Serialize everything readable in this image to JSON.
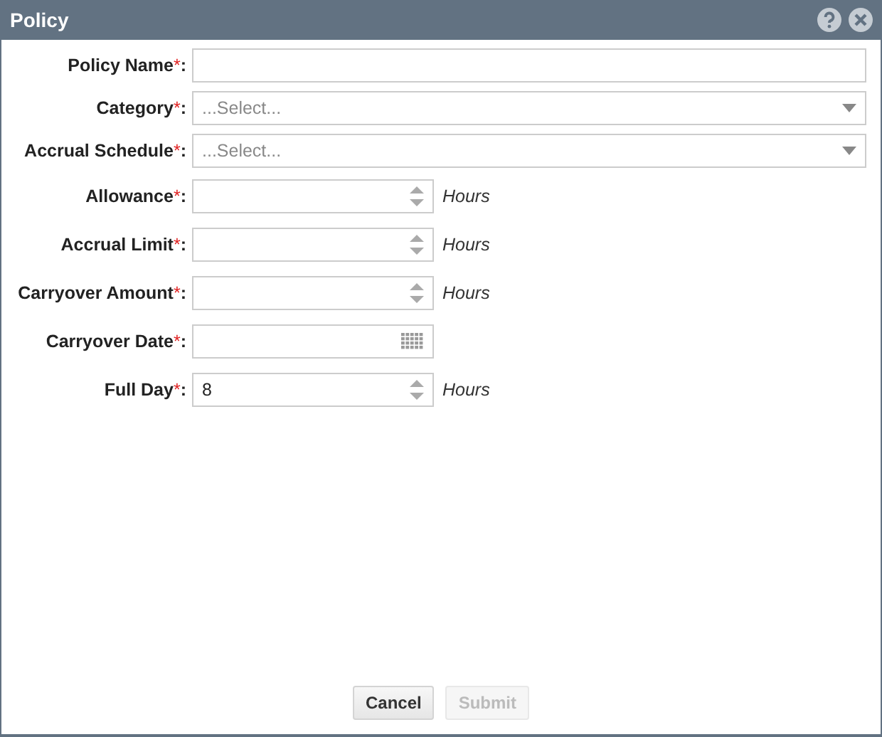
{
  "window": {
    "title": "Policy"
  },
  "fields": [
    {
      "kind": "text",
      "label": "Policy Name",
      "mark": "*",
      "colon": ":"
    },
    {
      "kind": "select",
      "label": "Category",
      "mark": "*",
      "colon": ":",
      "placeholder": "...Select..."
    },
    {
      "kind": "select",
      "label": "Accrual Schedule",
      "mark": "*",
      "colon": ":",
      "placeholder": "...Select..."
    },
    {
      "kind": "number",
      "label": "Allowance",
      "mark": "*",
      "colon": ":",
      "unit": "Hours"
    },
    {
      "kind": "number",
      "label": "Accrual Limit",
      "mark": "*",
      "colon": ":",
      "unit": "Hours"
    },
    {
      "kind": "number",
      "label": "Carryover Amount",
      "mark": "*",
      "colon": ":",
      "unit": "Hours"
    },
    {
      "kind": "date",
      "label": "Carryover Date",
      "mark": "*",
      "colon": ":"
    },
    {
      "kind": "number",
      "label": "Full Day",
      "mark": "*",
      "colon": ":",
      "value": "8",
      "unit": "Hours"
    }
  ],
  "buttons": [
    {
      "label": "Cancel",
      "disabled": false
    },
    {
      "label": "Submit",
      "disabled": true
    }
  ]
}
